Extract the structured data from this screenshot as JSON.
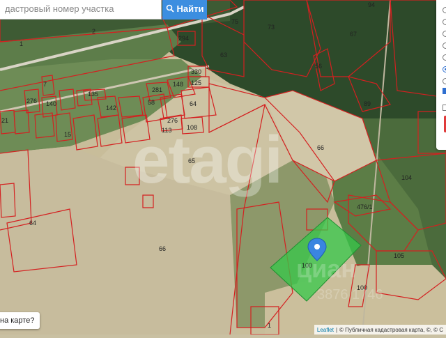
{
  "search": {
    "placeholder": "дастровый номер участка",
    "button_label": "Найти",
    "button_icon": "search-icon"
  },
  "map": {
    "plots": [
      {
        "label": "1",
        "id": "p1"
      },
      {
        "label": "2",
        "id": "p2"
      },
      {
        "label": "294",
        "id": "p294"
      },
      {
        "label": "63",
        "id": "p63a"
      },
      {
        "label": "73",
        "id": "p73"
      },
      {
        "label": "75",
        "id": "p75"
      },
      {
        "label": "94",
        "id": "p94"
      },
      {
        "label": "67",
        "id": "p67"
      },
      {
        "label": "56",
        "id": "p56"
      },
      {
        "label": "89",
        "id": "p89"
      },
      {
        "label": "330",
        "id": "p330"
      },
      {
        "label": "125",
        "id": "p125"
      },
      {
        "label": "148",
        "id": "p148"
      },
      {
        "label": "281",
        "id": "p281"
      },
      {
        "label": "135",
        "id": "p135"
      },
      {
        "label": "7",
        "id": "p7"
      },
      {
        "label": "276",
        "id": "p276a"
      },
      {
        "label": "140",
        "id": "p140"
      },
      {
        "label": "142",
        "id": "p142"
      },
      {
        "label": "64",
        "id": "p64a"
      },
      {
        "label": "276",
        "id": "p276b"
      },
      {
        "label": "113",
        "id": "p113"
      },
      {
        "label": "108",
        "id": "p108"
      },
      {
        "label": "66",
        "id": "p66a"
      },
      {
        "label": "65",
        "id": "p65"
      },
      {
        "label": "104",
        "id": "p104"
      },
      {
        "label": "476/1",
        "id": "p476"
      },
      {
        "label": "64",
        "id": "p64b"
      },
      {
        "label": "66",
        "id": "p66b"
      },
      {
        "label": "105",
        "id": "p105"
      },
      {
        "label": "100",
        "id": "p100"
      },
      {
        "label": "100",
        "id": "p100b"
      },
      {
        "label": "1",
        "id": "p1b"
      },
      {
        "label": "58",
        "id": "p58"
      },
      {
        "label": "21",
        "id": "p21"
      },
      {
        "label": "15",
        "id": "p15"
      }
    ],
    "highlight_color": "#35c84a",
    "boundary_color": "#d42020",
    "marker_color": "#3a85e0"
  },
  "watermark": {
    "text": "etagi",
    "text2": "циан",
    "text3": "3876 1746"
  },
  "side_panel": {
    "radios_checked_index": 5,
    "checkbox_checked": true
  },
  "help": {
    "question": "на карте?"
  },
  "attribution": {
    "leaflet": "Leaflet",
    "separator": "|",
    "copyright": "© Публичная кадастровая карта, ©, © С"
  }
}
